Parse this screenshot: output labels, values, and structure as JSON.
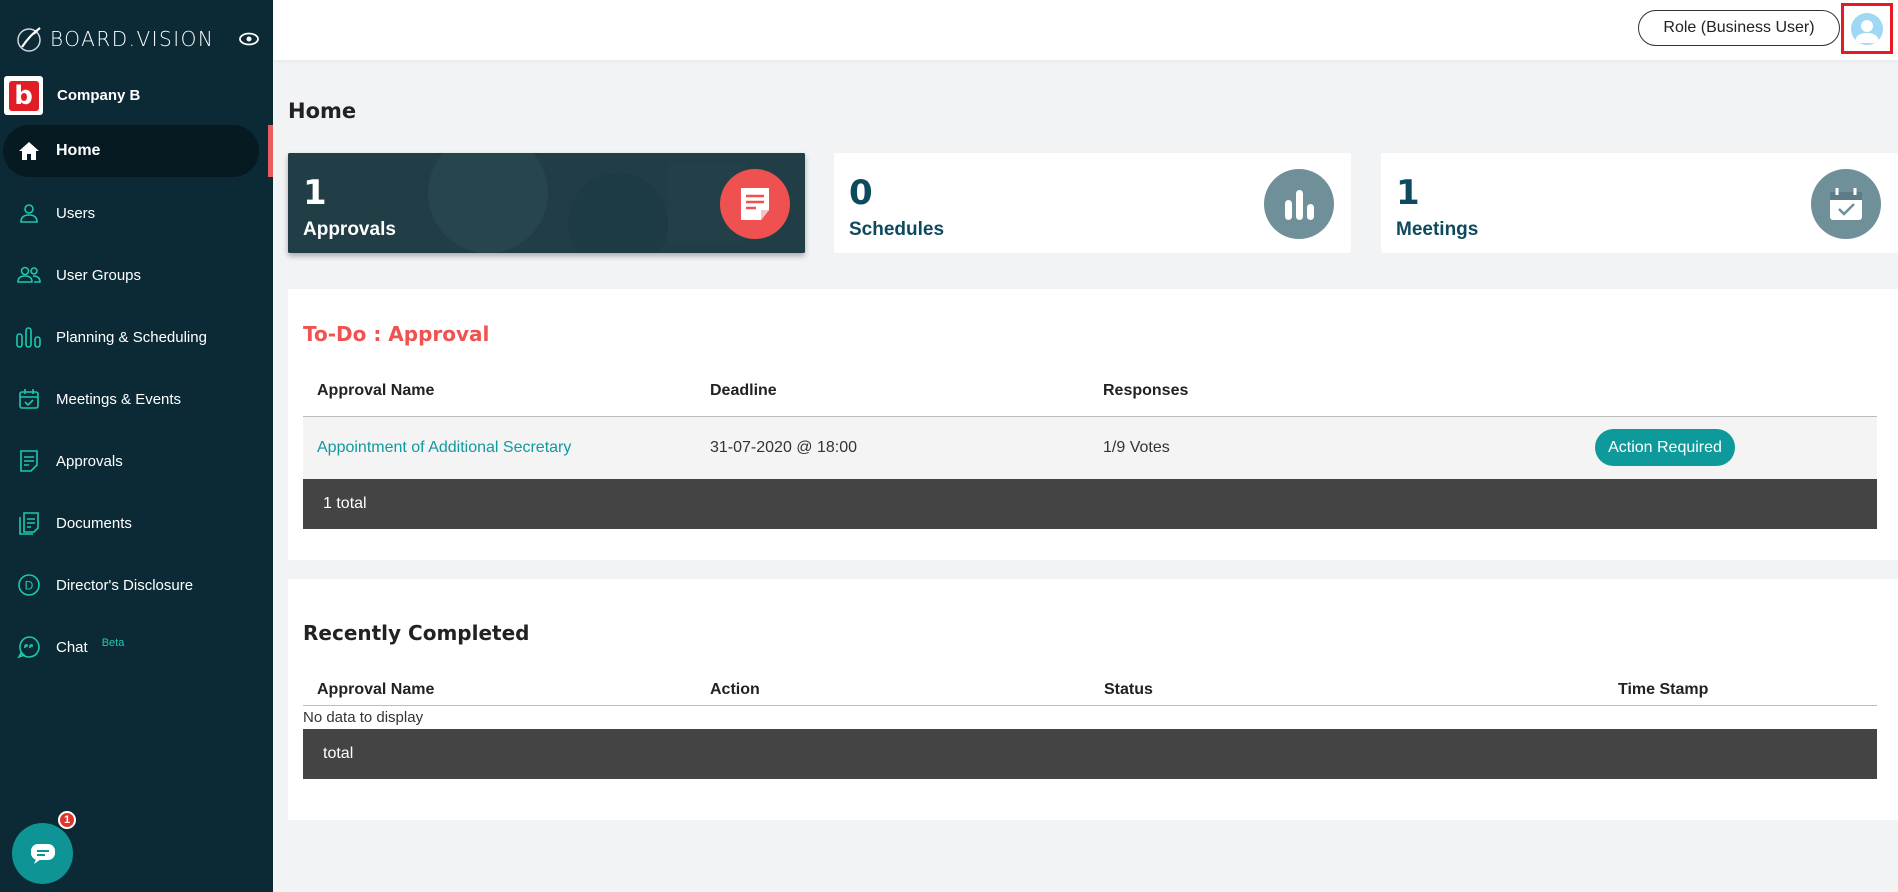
{
  "brand": {
    "name": "BOARD.VISION"
  },
  "company": {
    "logo_letter": "b",
    "name": "Company B"
  },
  "sidebar": {
    "items": [
      {
        "label": "Home",
        "icon": "home-icon"
      },
      {
        "label": "Users",
        "icon": "user-icon"
      },
      {
        "label": "User Groups",
        "icon": "users-icon"
      },
      {
        "label": "Planning & Scheduling",
        "icon": "bar-chart-icon"
      },
      {
        "label": "Meetings & Events",
        "icon": "calendar-check-icon"
      },
      {
        "label": "Approvals",
        "icon": "document-list-icon"
      },
      {
        "label": "Documents",
        "icon": "documents-icon"
      },
      {
        "label": "Director's Disclosure",
        "icon": "d-circle-icon"
      },
      {
        "label": "Chat",
        "icon": "chat-quote-icon",
        "badge": "Beta"
      }
    ],
    "active_index": 0
  },
  "chat_widget": {
    "badge_count": "1"
  },
  "header": {
    "role_label": "Role (Business User)"
  },
  "page": {
    "title": "Home"
  },
  "cards": [
    {
      "count": "1",
      "label": "Approvals",
      "icon": "document-icon"
    },
    {
      "count": "0",
      "label": "Schedules",
      "icon": "bar-chart-icon"
    },
    {
      "count": "1",
      "label": "Meetings",
      "icon": "calendar-icon"
    }
  ],
  "todo": {
    "title": "To-Do : Approval",
    "columns": [
      "Approval Name",
      "Deadline",
      "Responses"
    ],
    "rows": [
      {
        "name": "Appointment of Additional Secretary",
        "deadline": "31-07-2020 @ 18:00",
        "responses": "1/9 Votes",
        "action": "Action Required"
      }
    ],
    "footer": "1 total"
  },
  "completed": {
    "title": "Recently Completed",
    "columns": [
      "Approval Name",
      "Action",
      "Status",
      "Time Stamp"
    ],
    "empty_text": "No data to display",
    "footer": "total"
  },
  "colors": {
    "sidebar_bg": "#0b2a35",
    "accent_teal": "#0e9a9a",
    "accent_red": "#e95d5d",
    "title_red": "#f0524f"
  }
}
